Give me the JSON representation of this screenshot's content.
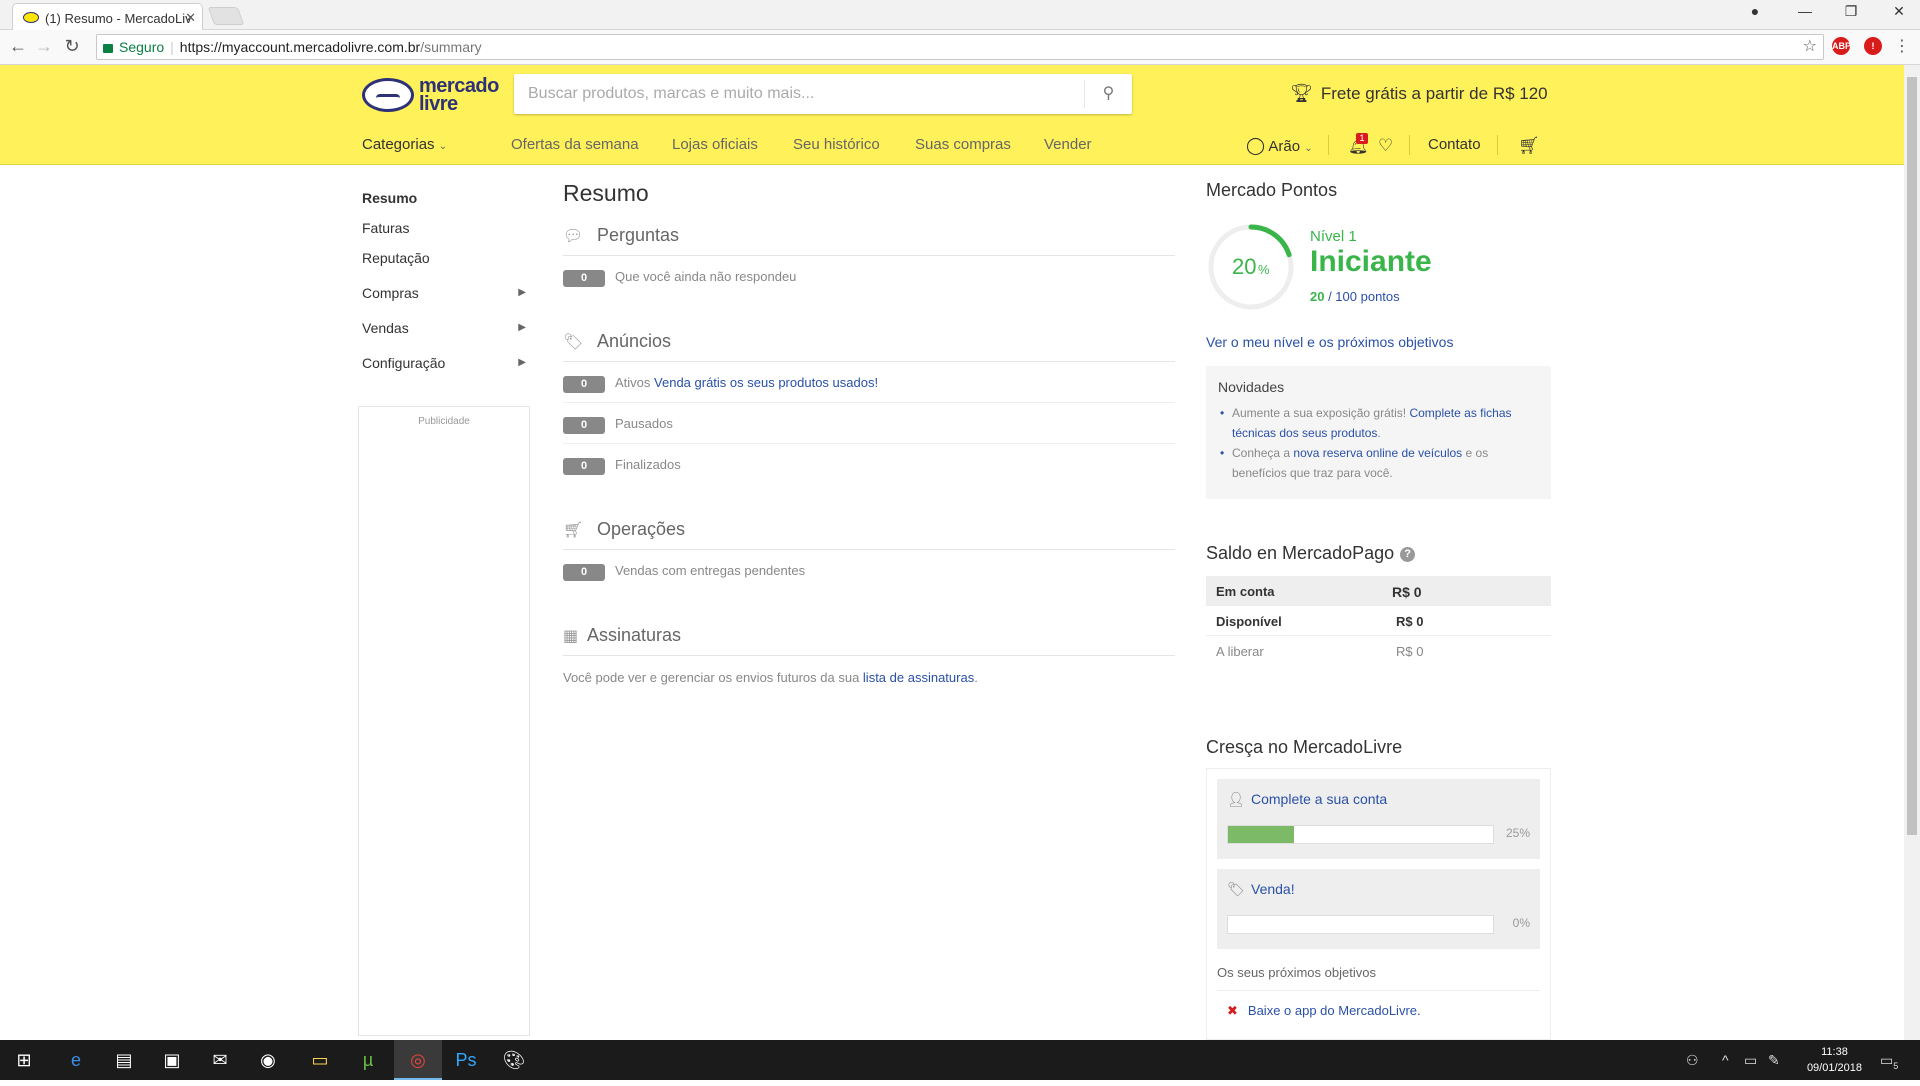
{
  "browser": {
    "tab_title": "(1) Resumo - MercadoLiv",
    "secure_label": "Seguro",
    "url_host": "https://myaccount.mercadolivre.com.br",
    "url_path": "/summary"
  },
  "header": {
    "logo_line1": "mercado",
    "logo_line2": "livre",
    "search_placeholder": "Buscar produtos, marcas e muito mais...",
    "promo": "Frete grátis a partir de R$ 120",
    "categories": "Categorias",
    "links": [
      "Ofertas da semana",
      "Lojas oficiais",
      "Seu histórico",
      "Suas compras",
      "Vender"
    ],
    "user": "Arão",
    "notifications_count": "1",
    "contact": "Contato"
  },
  "sidebar": {
    "items": [
      {
        "label": "Resumo"
      },
      {
        "label": "Faturas"
      },
      {
        "label": "Reputação"
      },
      {
        "label": "Compras"
      },
      {
        "label": "Vendas"
      },
      {
        "label": "Configuração"
      }
    ],
    "ad_label": "Publicidade"
  },
  "main": {
    "title": "Resumo",
    "perguntas": {
      "title": "Perguntas",
      "count": "0",
      "text": "Que você ainda não respondeu"
    },
    "anuncios": {
      "title": "Anúncios",
      "ativos": {
        "count": "0",
        "label": "Ativos",
        "link": "Venda grátis os seus produtos usados!"
      },
      "pausados": {
        "count": "0",
        "label": "Pausados"
      },
      "finalizados": {
        "count": "0",
        "label": "Finalizados"
      }
    },
    "operacoes": {
      "title": "Operações",
      "count": "0",
      "text": "Vendas com entregas pendentes"
    },
    "assinaturas": {
      "title": "Assinaturas",
      "text": "Você pode ver e gerenciar os envios futuros da sua",
      "link": "lista de assinaturas",
      "end": "."
    }
  },
  "pontos": {
    "title": "Mercado Pontos",
    "percent_num": "20",
    "percent_sign": "%",
    "progress": 0.2,
    "level_small": "Nível 1",
    "level_name": "Iniciante",
    "points": "20",
    "points_rest": " / 100 pontos",
    "link": "Ver o meu nível e os próximos objetivos"
  },
  "novidades": {
    "title": "Novidades",
    "item1_text": "Aumente a sua exposição grátis!",
    "item1_link": "Complete as fichas técnicas dos seus produtos",
    "item1_end": ".",
    "item2_text": "Conheça a",
    "item2_link": "nova reserva online de veículos",
    "item2_end": "e os benefícios que traz para você."
  },
  "saldo": {
    "title": "Saldo en MercadoPago",
    "help": "?",
    "rows": [
      {
        "label": "Em conta",
        "value": "R$ 0"
      },
      {
        "label": "Disponível",
        "value": "R$ 0"
      },
      {
        "label": "A liberar",
        "value": "R$ 0"
      }
    ]
  },
  "cresca": {
    "title": "Cresça no MercadoLivre",
    "goal1": {
      "title": "Complete a sua conta",
      "percent": "25%",
      "progress": 0.25
    },
    "goal2": {
      "title": "Venda!",
      "percent": "0%",
      "progress": 0
    },
    "next_title": "Os seus próximos objetivos",
    "next_item": "Baixe o app do MercadoLivre."
  },
  "taskbar": {
    "time": "11:38",
    "date": "09/01/2018",
    "notif_count": "5"
  },
  "colors": {
    "brand_yellow": "#fff159",
    "brand_blue": "#2d3277",
    "link": "#2a50a8",
    "green": "#39b54a"
  }
}
